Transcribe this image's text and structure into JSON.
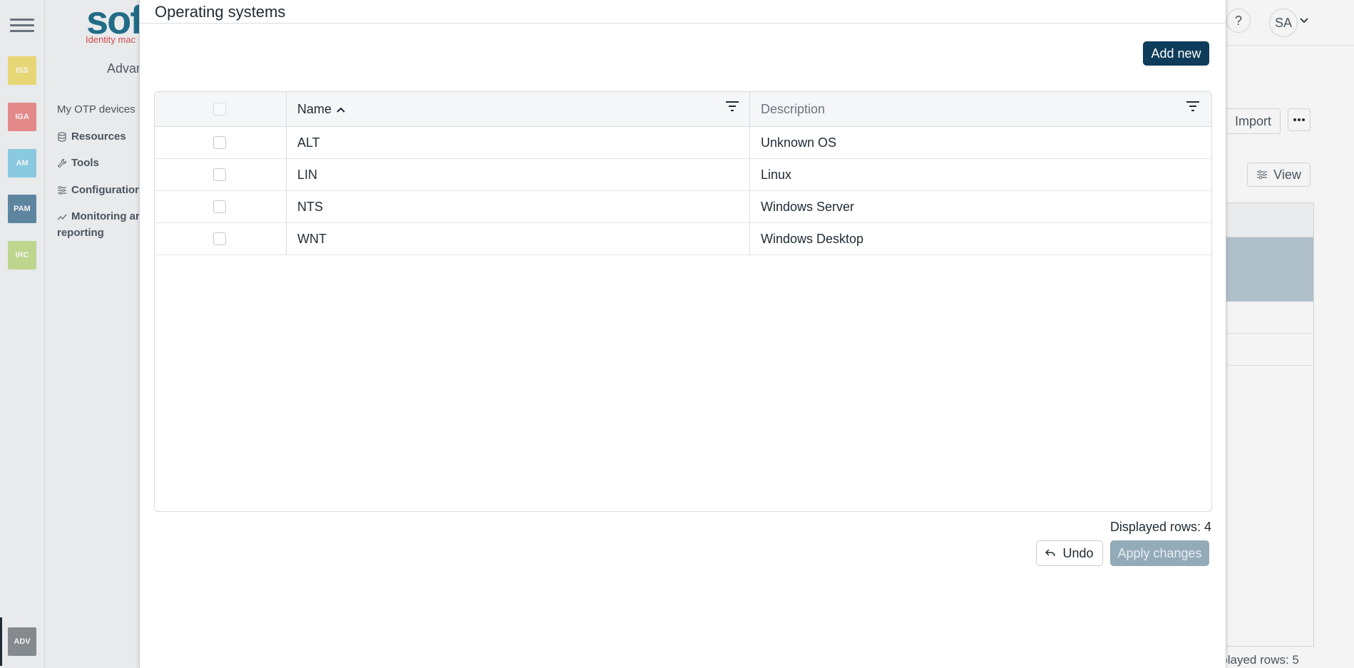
{
  "background": {
    "modules": [
      {
        "label": "ISS",
        "color": "#f2e079"
      },
      {
        "label": "IGA",
        "color": "#ee8e8e"
      },
      {
        "label": "AM",
        "color": "#8fd3ea"
      },
      {
        "label": "PAM",
        "color": "#5f8aa6"
      },
      {
        "label": "IRC",
        "color": "#c5df92"
      },
      {
        "label": "ADV",
        "color": "#8a8f94"
      }
    ],
    "logo_text": "sof",
    "logo_tagline": "Identity mac",
    "section_title": "Advar",
    "sidebar_items": [
      {
        "label": "My OTP devices",
        "icon": "none"
      },
      {
        "label": "Resources",
        "icon": "database-icon"
      },
      {
        "label": "Tools",
        "icon": "wrench-icon"
      },
      {
        "label": "Configuration",
        "icon": "sliders-icon"
      },
      {
        "label": "Monitoring ar",
        "label2": "reporting",
        "icon": "chart-line-icon"
      }
    ],
    "help_label": "?",
    "avatar_initials": "SA",
    "import_label": "Import",
    "view_label": "View",
    "displayed_rows": "isplayed rows: 5"
  },
  "modal": {
    "title": "Operating systems",
    "add_new_label": "Add new",
    "columns": {
      "name": "Name",
      "description": "Description"
    },
    "sort": {
      "column": "name",
      "direction": "ascending"
    },
    "rows": [
      {
        "name": "ALT",
        "description": "Unknown OS"
      },
      {
        "name": "LIN",
        "description": "Linux"
      },
      {
        "name": "NTS",
        "description": "Windows Server"
      },
      {
        "name": "WNT",
        "description": "Windows Desktop"
      }
    ],
    "displayed_rows": "Displayed rows: 4",
    "undo_label": "Undo",
    "apply_label": "Apply changes",
    "colors": {
      "primary": "#0f3c5a",
      "disabled": "#93aab9"
    }
  }
}
